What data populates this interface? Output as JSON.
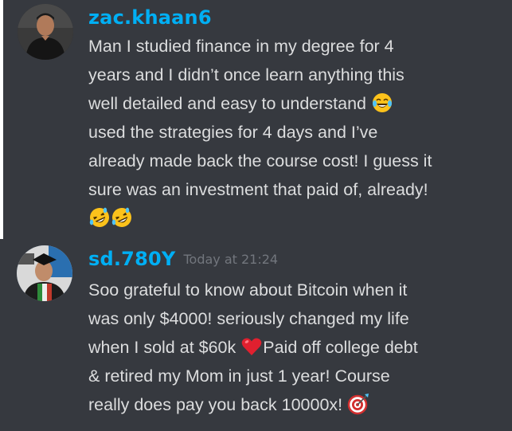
{
  "messages": [
    {
      "username": "zac.khaan6",
      "timestamp": "",
      "lines": [
        "Man I studied finance in my degree for 4",
        "years and I didn’t once learn anything this",
        "well detailed and easy to understand",
        "used the strategies for 4 days and I’ve",
        "already made back the course cost! I guess it",
        "sure was an investment that paid of, already!"
      ],
      "emojis": [
        "face-with-tears-of-joy-icon",
        "rolling-on-floor-laughing-icon",
        "rolling-on-floor-laughing-icon"
      ]
    },
    {
      "username": "sd.780Y",
      "timestamp": "Today at 21:24",
      "lines": [
        "Soo grateful to know about Bitcoin when it",
        "was only $4000! seriously changed my life",
        "when I sold at $60k",
        "Paid off college debt",
        "& retired my Mom in just 1 year! Course",
        "really does pay you back 10000x!"
      ],
      "emojis": [
        "red-heart-icon",
        "direct-hit-icon"
      ]
    }
  ],
  "colors": {
    "background": "#36393f",
    "username": "#00aff4",
    "text": "#dcddde",
    "timestamp": "#72767d"
  }
}
